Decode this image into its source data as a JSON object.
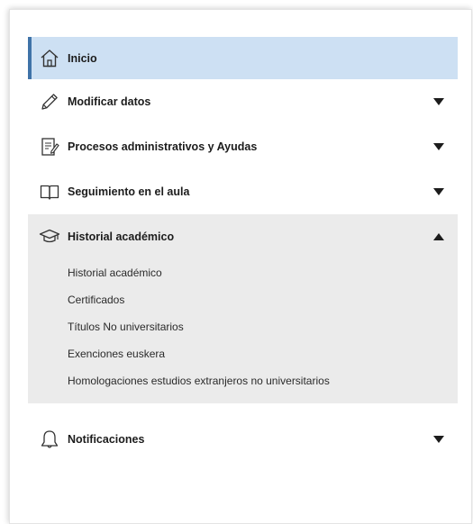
{
  "menu": {
    "home": {
      "label": "Inicio",
      "icon": "home-icon"
    },
    "items": [
      {
        "label": "Modificar datos",
        "icon": "pencil-icon",
        "caret": "down"
      },
      {
        "label": "Procesos administrativos y Ayudas",
        "icon": "document-icon",
        "caret": "down"
      },
      {
        "label": "Seguimiento en el aula",
        "icon": "book-icon",
        "caret": "down"
      }
    ],
    "expanded": {
      "label": "Historial académico",
      "icon": "graduation-cap-icon",
      "caret": "up",
      "subitems": [
        "Historial académico",
        "Certificados",
        "Títulos No universitarios",
        "Exenciones euskera",
        "Homologaciones estudios extranjeros no universitarios"
      ]
    },
    "notifications": {
      "label": "Notificaciones",
      "icon": "bell-icon",
      "caret": "down"
    }
  },
  "colors": {
    "active_bg": "#cde0f3",
    "active_bar": "#3f73a8",
    "expanded_bg": "#ebebeb"
  }
}
